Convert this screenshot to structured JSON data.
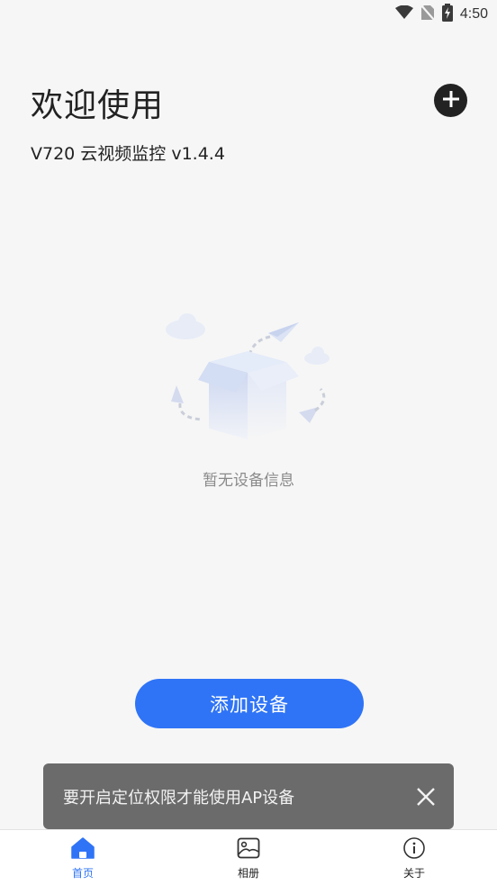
{
  "status_bar": {
    "time": "4:50",
    "icons": [
      "wifi-icon",
      "no-sim-icon",
      "battery-charging-icon"
    ]
  },
  "header": {
    "title": "欢迎使用",
    "subtitle": "V720 云视频监控 v1.4.4",
    "add_icon": "plus-circle-icon"
  },
  "empty_state": {
    "message": "暂无设备信息",
    "illustration": "empty-box-illustration"
  },
  "add_device_button": {
    "label": "添加设备"
  },
  "toast": {
    "message": "要开启定位权限才能使用AP设备",
    "close_icon": "close-icon"
  },
  "bottom_nav": {
    "items": [
      {
        "label": "首页",
        "icon": "home-icon",
        "active": true
      },
      {
        "label": "相册",
        "icon": "album-icon",
        "active": false
      },
      {
        "label": "关于",
        "icon": "info-icon",
        "active": false
      }
    ]
  },
  "colors": {
    "accent": "#2f74f6",
    "background": "#f6f6f6",
    "toast_bg": "#6b6b6b"
  }
}
